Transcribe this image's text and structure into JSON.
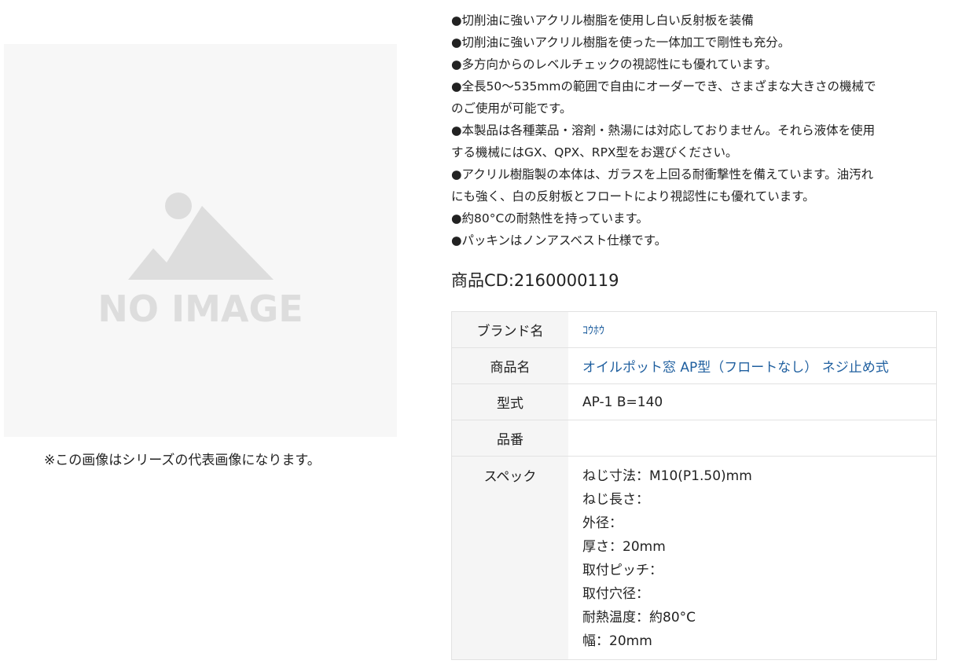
{
  "image": {
    "placeholder_text": "NO IMAGE",
    "caption": "※この画像はシリーズの代表画像になります。"
  },
  "features": [
    "●切削油に強いアクリル樹脂を使用し白い反射板を装備",
    "●切削油に強いアクリル樹脂を使った一体加工で剛性も充分。",
    "●多方向からのレベルチェックの視認性にも優れています。",
    "●全長50～535mmの範囲で自由にオーダーでき、さまざまな大きさの機械で",
    "のご使用が可能です。",
    "●本製品は各種薬品・溶剤・熱湯には対応しておりません。それら液体を使用",
    "する機械にはGX、QPX、RPX型をお選びください。",
    "●アクリル樹脂製の本体は、ガラスを上回る耐衝撃性を備えています。油汚れ",
    "にも強く、白の反射板とフロートにより視認性にも優れています。",
    "●約80°Cの耐熱性を持っています。",
    "●パッキンはノンアスベスト仕様です。"
  ],
  "product_code": "商品CD:2160000119",
  "table": {
    "brand": {
      "label": "ブランド名",
      "value": "ｺｳﾎｳ"
    },
    "product_name": {
      "label": "商品名",
      "value": "オイルポット窓 AP型（フロートなし） ネジ止め式"
    },
    "model": {
      "label": "型式",
      "value": "AP-1 B=140"
    },
    "part_number": {
      "label": "品番",
      "value": ""
    },
    "spec": {
      "label": "スペック",
      "lines": [
        "ねじ寸法：M10(P1.50)mm",
        "ねじ長さ：",
        "外径：",
        "厚さ：20mm",
        "取付ピッチ：",
        "取付穴径：",
        "耐熱温度：約80°C",
        "幅：20mm"
      ]
    }
  },
  "colors": {
    "link": "#1f5f9f",
    "placeholder_bg": "#f7f7f7",
    "placeholder_fg": "#dddddd",
    "header_bg": "#f5f5f5"
  }
}
